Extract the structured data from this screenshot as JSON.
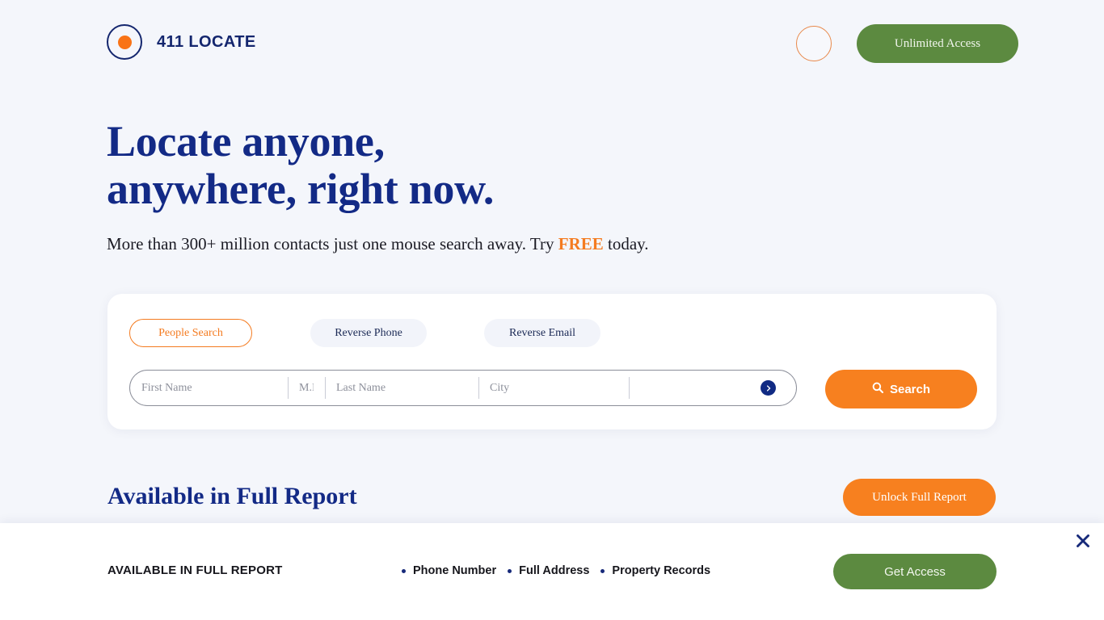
{
  "header": {
    "logo_text": "411 LOCATE",
    "unlimited_access_label": "Unlimited Access"
  },
  "hero": {
    "headline_line1": "Locate anyone,",
    "headline_line2": "anywhere, right now.",
    "sub_before": "More than 300+ million contacts just one mouse search away. Try ",
    "sub_highlight": "FREE",
    "sub_after": " today."
  },
  "search": {
    "tabs": [
      {
        "label": "People Search",
        "active": true
      },
      {
        "label": "Reverse Phone",
        "active": false
      },
      {
        "label": "Reverse Email",
        "active": false
      }
    ],
    "fields": [
      {
        "name": "first-name",
        "placeholder": "First Name",
        "value": ""
      },
      {
        "name": "middle-initial",
        "placeholder": "M.I.",
        "value": ""
      },
      {
        "name": "last-name",
        "placeholder": "Last Name",
        "value": ""
      },
      {
        "name": "city",
        "placeholder": "City",
        "value": ""
      },
      {
        "name": "state",
        "placeholder": "",
        "value": ""
      }
    ],
    "search_button_label": "Search"
  },
  "report": {
    "title": "Available in Full Report",
    "unlock_label": "Unlock Full Report"
  },
  "bottom_bar": {
    "title": "AVAILABLE IN FULL REPORT",
    "features": [
      "Phone Number",
      "Full Address",
      "Property Records"
    ],
    "cta_label": "Get Access"
  },
  "colors": {
    "navy": "#132a86",
    "orange": "#f7801f",
    "green": "#5c8a40",
    "page_bg": "#f4f6fb"
  }
}
